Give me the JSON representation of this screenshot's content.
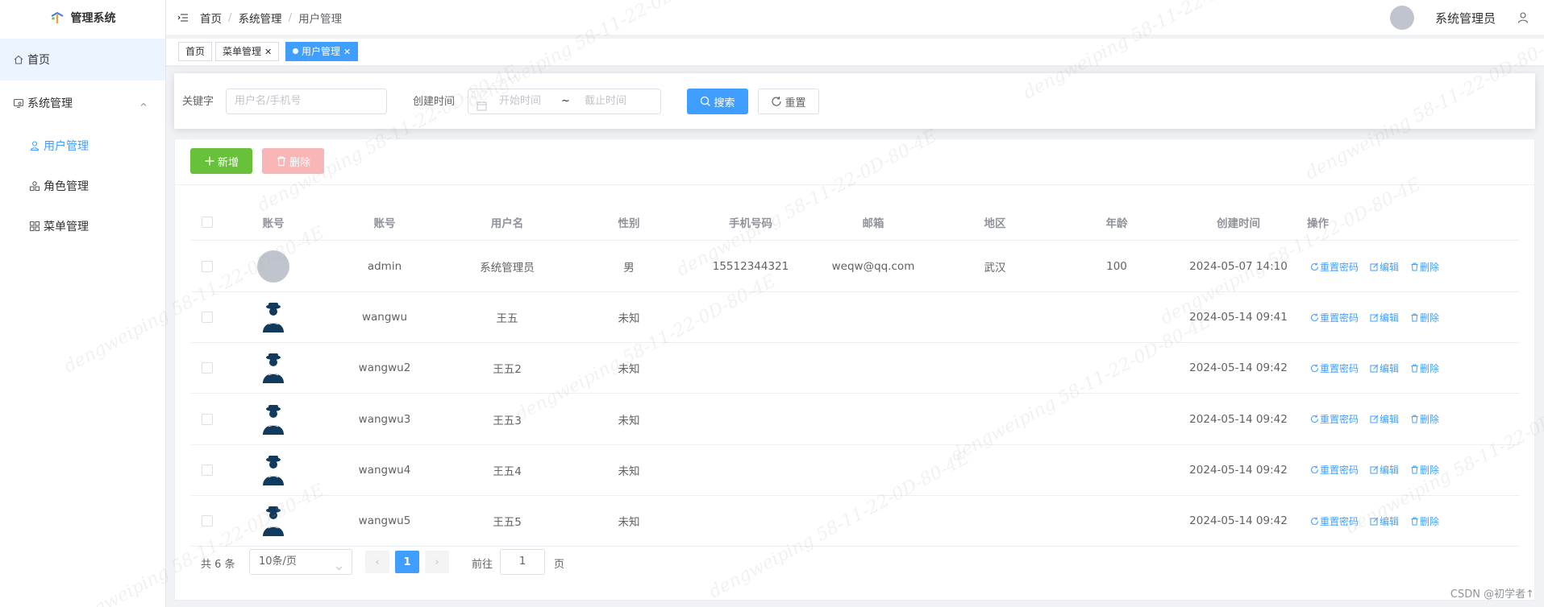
{
  "app": {
    "title": "管理系统"
  },
  "sidebar": {
    "home": "首页",
    "group": "系统管理",
    "items": [
      {
        "label": "用户管理",
        "active": true
      },
      {
        "label": "角色管理",
        "active": false
      },
      {
        "label": "菜单管理",
        "active": false
      }
    ]
  },
  "topbar": {
    "breadcrumb": [
      "首页",
      "系统管理",
      "用户管理"
    ],
    "separator": "/",
    "user_name": "系统管理员"
  },
  "tabs": [
    {
      "label": "首页",
      "closable": false,
      "active": false
    },
    {
      "label": "菜单管理",
      "closable": true,
      "active": false
    },
    {
      "label": "用户管理",
      "closable": true,
      "active": true
    }
  ],
  "tab_close": "✕",
  "search": {
    "keyword_label": "关键字",
    "keyword_placeholder": "用户名/手机号",
    "date_label": "创建时间",
    "start_placeholder": "开始时间",
    "range_separator": "~",
    "end_placeholder": "截止时间",
    "search_button": "搜索",
    "reset_button": "重置"
  },
  "toolbar": {
    "add_button": "新增",
    "delete_button": "删除"
  },
  "table": {
    "columns": [
      "账号",
      "账号",
      "用户名",
      "性别",
      "手机号码",
      "邮箱",
      "地区",
      "年龄",
      "创建时间",
      "操作"
    ],
    "rows": [
      {
        "avatar": "gray",
        "account": "admin",
        "username": "系统管理员",
        "gender": "男",
        "phone": "15512344321",
        "email": "weqw@qq.com",
        "region": "武汉",
        "age": "100",
        "created": "2024-05-07 14:10"
      },
      {
        "avatar": "image",
        "account": "wangwu",
        "username": "王五",
        "gender": "未知",
        "phone": "",
        "email": "",
        "region": "",
        "age": "",
        "created": "2024-05-14 09:41"
      },
      {
        "avatar": "image",
        "account": "wangwu2",
        "username": "王五2",
        "gender": "未知",
        "phone": "",
        "email": "",
        "region": "",
        "age": "",
        "created": "2024-05-14 09:42"
      },
      {
        "avatar": "image",
        "account": "wangwu3",
        "username": "王五3",
        "gender": "未知",
        "phone": "",
        "email": "",
        "region": "",
        "age": "",
        "created": "2024-05-14 09:42"
      },
      {
        "avatar": "image",
        "account": "wangwu4",
        "username": "王五4",
        "gender": "未知",
        "phone": "",
        "email": "",
        "region": "",
        "age": "",
        "created": "2024-05-14 09:42"
      },
      {
        "avatar": "image",
        "account": "wangwu5",
        "username": "王五5",
        "gender": "未知",
        "phone": "",
        "email": "",
        "region": "",
        "age": "",
        "created": "2024-05-14 09:42"
      }
    ],
    "ops": {
      "reset_password": "重置密码",
      "edit": "编辑",
      "delete": "删除"
    }
  },
  "pagination": {
    "total": "共 6 条",
    "page_size": "10条/页",
    "current_page": "1",
    "goto_label": "前往",
    "goto_value": "1",
    "page_suffix": "页",
    "prev": "‹",
    "next": "›"
  },
  "footer": {
    "credit": "CSDN @初学者↑"
  },
  "watermark": {
    "text": "dengweiping 58-11-22-0D-80-4E"
  },
  "colors": {
    "primary": "#409eff",
    "success": "#67c23a",
    "danger_disabled": "#fab6b6",
    "menu_active_bg": "#ecf5ff"
  }
}
